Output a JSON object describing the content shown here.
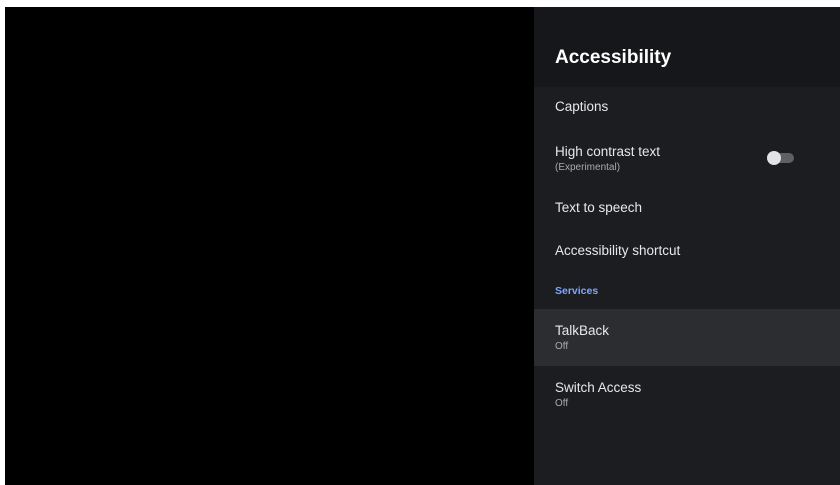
{
  "panel": {
    "title": "Accessibility"
  },
  "items": [
    {
      "label": "Captions"
    },
    {
      "label": "High contrast text",
      "sub": "(Experimental)",
      "toggle_on": false
    },
    {
      "label": "Text to speech"
    },
    {
      "label": "Accessibility shortcut"
    }
  ],
  "services": {
    "header": "Services",
    "items": [
      {
        "label": "TalkBack",
        "status": "Off",
        "focused": true
      },
      {
        "label": "Switch Access",
        "status": "Off",
        "focused": false
      }
    ]
  },
  "colors": {
    "panel_bg": "#1c1d20",
    "header_bg": "#16171a",
    "focus_bg": "#2c2d30",
    "section_accent": "#7fa6ff"
  }
}
